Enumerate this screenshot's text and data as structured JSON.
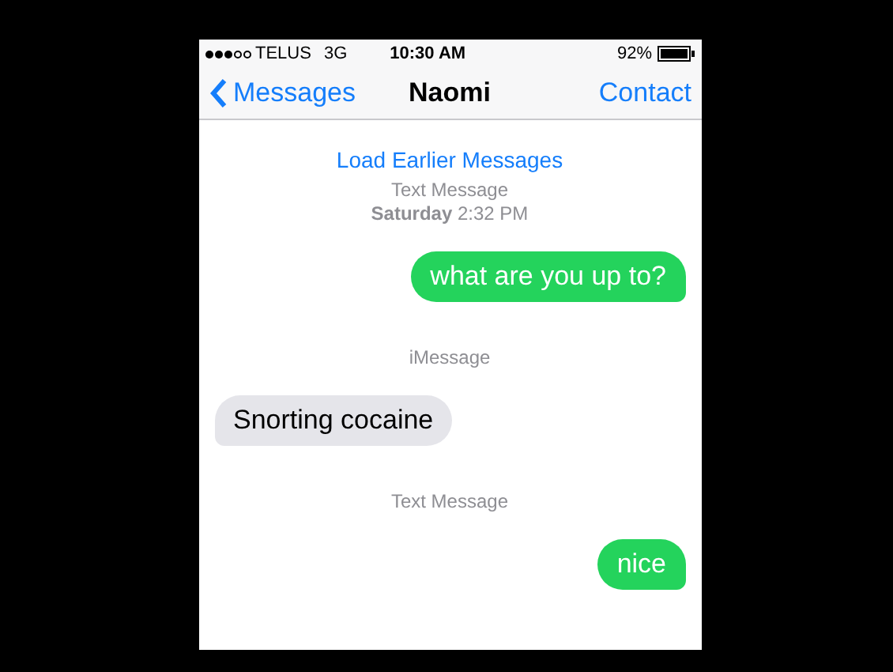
{
  "status_bar": {
    "carrier": "TELUS",
    "network": "3G",
    "time": "10:30 AM",
    "battery": "92%"
  },
  "nav_bar": {
    "back": "Messages",
    "title": "Naomi",
    "action": "Contact"
  },
  "load_earlier": "Load Earlier Messages",
  "messages": [
    {
      "kind": "label",
      "text": "Text Message"
    },
    {
      "kind": "label",
      "text": "**Saturday** 2:32 PM"
    },
    {
      "kind": "sent",
      "text": "what are you up to?"
    },
    {
      "kind": "label",
      "text": "iMessage"
    },
    {
      "kind": "received",
      "text": "Snorting cocaine"
    },
    {
      "kind": "label",
      "text": "Text Message"
    },
    {
      "kind": "sent",
      "text": "nice"
    }
  ]
}
